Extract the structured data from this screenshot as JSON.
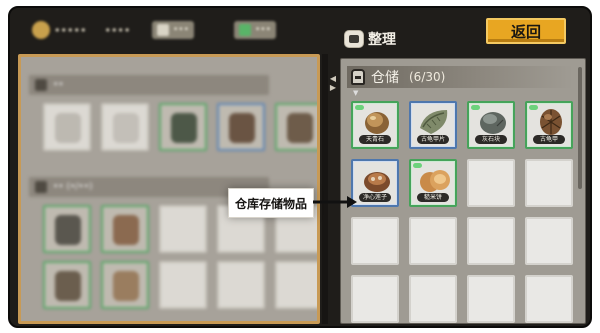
{
  "top_bar": {
    "player_name": "•••••",
    "gold": "••••",
    "resource_1": "•••",
    "resource_2": "•••",
    "sort_label": "整理",
    "back_label": "返回"
  },
  "bag": {
    "section_1_title": "••",
    "section_2_title": "•• (•/••)"
  },
  "warehouse": {
    "title": "仓储",
    "count": "(6/30)",
    "items": [
      {
        "name": "天青石",
        "border": "green",
        "icon": "seed-pod-icon"
      },
      {
        "name": "古龟甲片",
        "border": "blue",
        "icon": "leaf-shell-icon"
      },
      {
        "name": "灰石块",
        "border": "green",
        "icon": "stone-icon"
      },
      {
        "name": "古龟甲",
        "border": "green",
        "icon": "turtle-shell-icon"
      },
      {
        "name": "净心莲子",
        "border": "blue",
        "icon": "lotus-seed-icon"
      },
      {
        "name": "糙米饼",
        "border": "green",
        "icon": "rice-cake-icon"
      }
    ]
  },
  "annotation": {
    "text": "仓库存储物品"
  },
  "colors": {
    "frame": "#1f1d1a",
    "back_button": "#e8a622",
    "left_panel_border": "#c89a55",
    "slot_green": "#46a35a",
    "slot_blue": "#4e77ad"
  }
}
